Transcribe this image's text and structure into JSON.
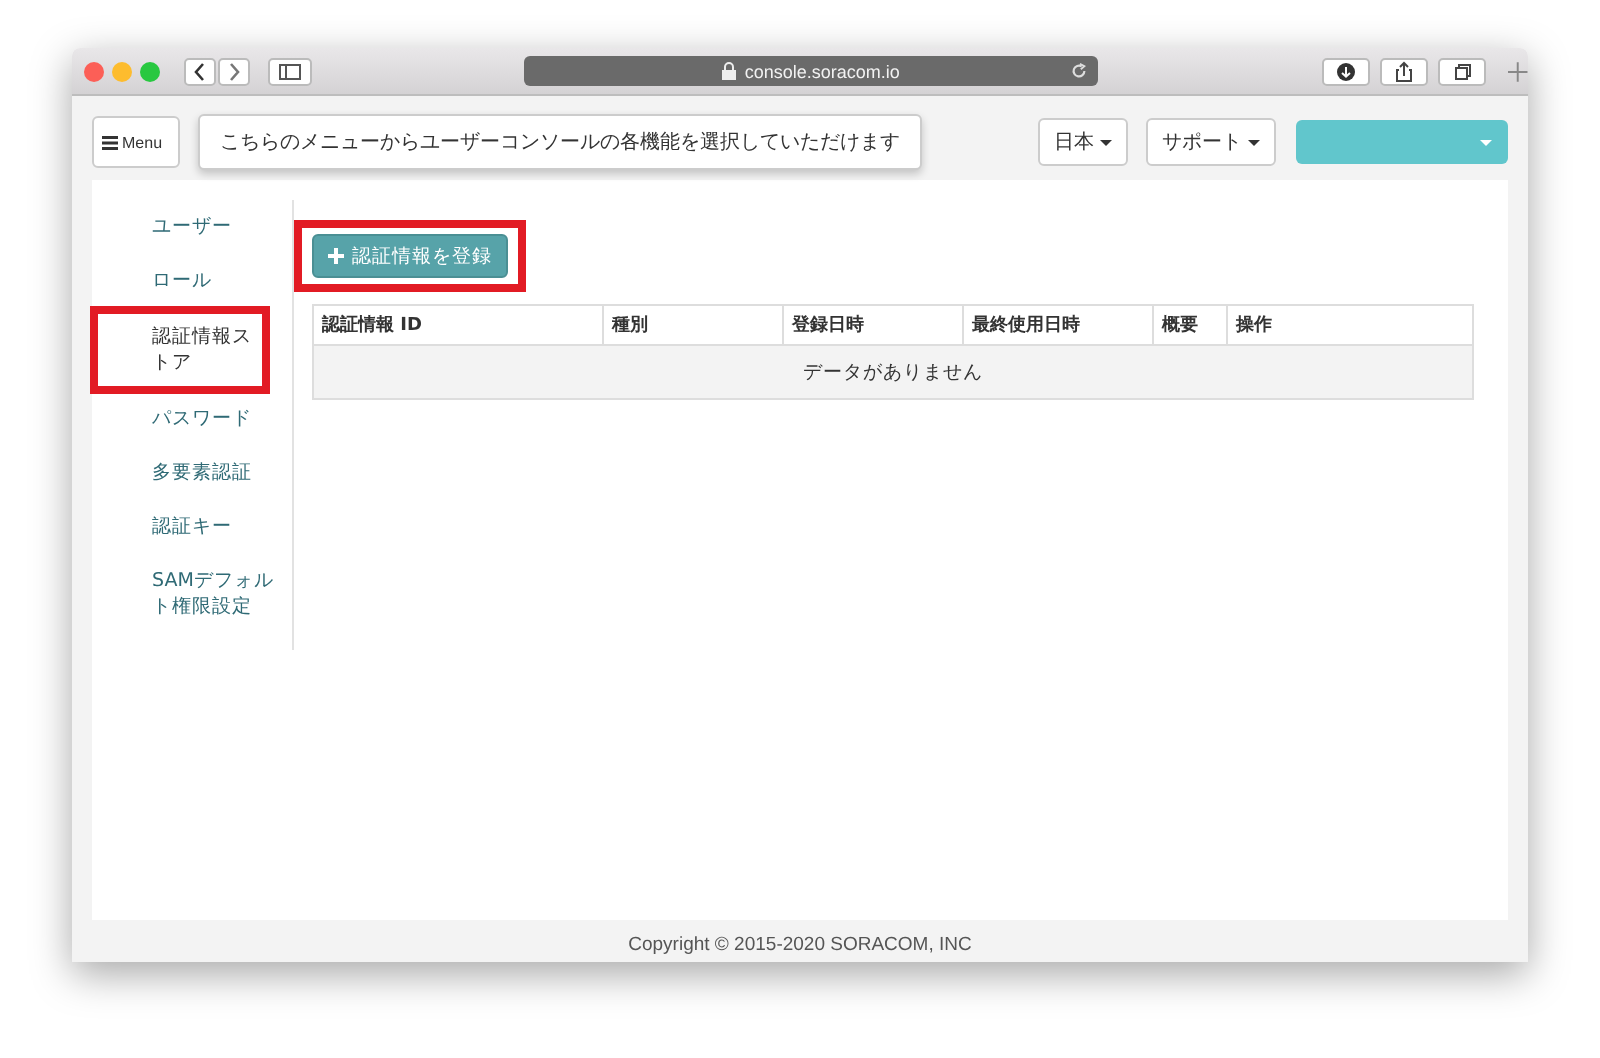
{
  "browser": {
    "url": "console.soracom.io"
  },
  "header": {
    "menu_button": "Menu",
    "tooltip": "こちらのメニューからユーザーコンソールの各機能を選択していただけます",
    "language_button": "日本",
    "support_button": "サポート"
  },
  "sidebar": {
    "items": [
      {
        "label": "ユーザー",
        "selected": false,
        "highlighted": false
      },
      {
        "label": "ロール",
        "selected": false,
        "highlighted": false
      },
      {
        "label": "認証情報ストア",
        "selected": true,
        "highlighted": true
      },
      {
        "label": "パスワード",
        "selected": false,
        "highlighted": false
      },
      {
        "label": "多要素認証",
        "selected": false,
        "highlighted": false
      },
      {
        "label": "認証キー",
        "selected": false,
        "highlighted": false
      },
      {
        "label": "SAMデフォルト権限設定",
        "selected": false,
        "highlighted": false
      }
    ]
  },
  "register_button": {
    "label": "認証情報を登録",
    "highlighted": true
  },
  "table": {
    "columns": [
      "認証情報 ID",
      "種別",
      "登録日時",
      "最終使用日時",
      "概要",
      "操作"
    ],
    "empty_message": "データがありません"
  },
  "footer": "Copyright © 2015-2020 SORACOM, INC"
}
